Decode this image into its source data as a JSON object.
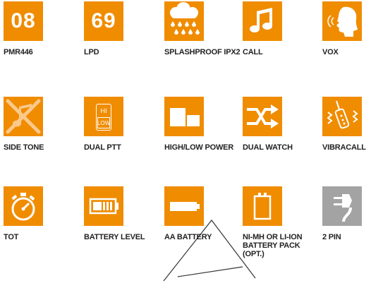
{
  "colors": {
    "tile": "#f08c00",
    "tile_gray": "#a3a3a3",
    "icon": "#ffffff",
    "watermark": "#000000"
  },
  "features": [
    {
      "label": "PMR446",
      "number": "08",
      "icon": "number-badge"
    },
    {
      "label": "LPD",
      "number": "69",
      "icon": "number-badge"
    },
    {
      "label": "SPLASHPROOF IPX2",
      "icon": "rain-cloud-icon"
    },
    {
      "label": "CALL",
      "icon": "music-note-icon"
    },
    {
      "label": "VOX",
      "icon": "speaking-head-icon"
    },
    {
      "label": "SIDE TONE",
      "icon": "muted-note-icon"
    },
    {
      "label": "DUAL PTT",
      "hi": "HI",
      "low": "LOW",
      "icon": "hi-low-switch-icon"
    },
    {
      "label": "HIGH/LOW POWER",
      "icon": "power-blocks-icon"
    },
    {
      "label": "DUAL WATCH",
      "icon": "shuffle-arrows-icon"
    },
    {
      "label": "VIBRACALL",
      "icon": "vibrating-radio-icon"
    },
    {
      "label": "TOT",
      "icon": "stopwatch-icon"
    },
    {
      "label": "BATTERY LEVEL",
      "icon": "battery-level-icon"
    },
    {
      "label": "AA BATTERY",
      "icon": "aa-battery-icon"
    },
    {
      "label": "NI-MH OR LI-ION BATTERY PACK (OPT.)",
      "icon": "battery-pack-icon"
    },
    {
      "label": "2 PIN",
      "icon": "two-pin-plug-icon"
    }
  ]
}
